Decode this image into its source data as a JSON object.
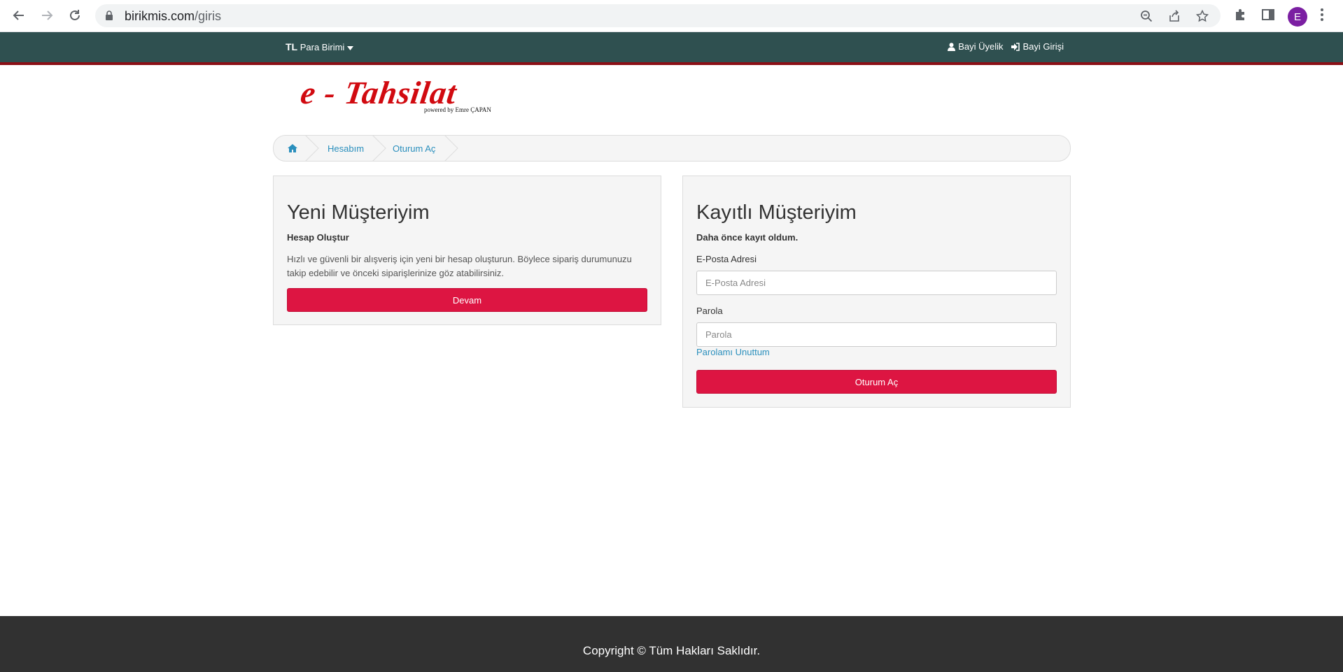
{
  "browser": {
    "url_domain": "birikmis.com",
    "url_path": "/giris",
    "profile_initial": "E"
  },
  "topbar": {
    "currency_code": "TL",
    "currency_label": "Para Birimi",
    "dealer_signup": "Bayi Üyelik",
    "dealer_login": "Bayi Girişi"
  },
  "logo": {
    "title": "e - Tahsilat",
    "subtitle": "powered by Emre ÇAPAN"
  },
  "breadcrumb": {
    "items": [
      "Hesabım",
      "Oturum Aç"
    ]
  },
  "new_customer": {
    "title": "Yeni Müşteriyim",
    "subtitle": "Hesap Oluştur",
    "description": "Hızlı ve güvenli bir alışveriş için yeni bir hesap oluşturun. Böylece sipariş durumunuzu takip edebilir ve önceki siparişlerinize göz atabilirsiniz.",
    "button": "Devam"
  },
  "returning_customer": {
    "title": "Kayıtlı Müşteriyim",
    "subtitle": "Daha önce kayıt oldum.",
    "email_label": "E-Posta Adresi",
    "email_placeholder": "E-Posta Adresi",
    "password_label": "Parola",
    "password_placeholder": "Parola",
    "forgot": "Parolamı Unuttum",
    "button": "Oturum Aç"
  },
  "footer": {
    "copyright": "Copyright © Tüm Hakları Saklıdır."
  },
  "colors": {
    "topbar": "#2f5050",
    "topbar_border": "#8b0f16",
    "accent_button": "#dd1542",
    "link": "#2a8fbd",
    "footer": "#313131"
  }
}
